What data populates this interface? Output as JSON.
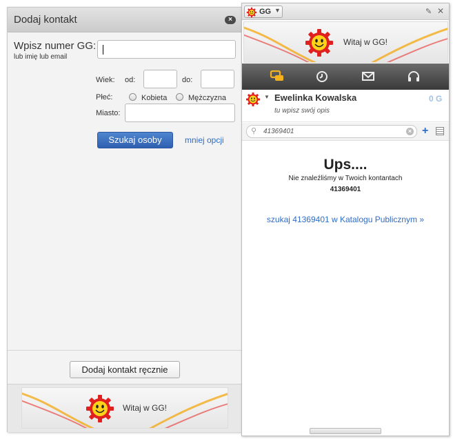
{
  "add_contact": {
    "title": "Dodaj kontakt",
    "gg_number_label": "Wpisz numer GG:",
    "gg_number_hint": "lub imię lub email",
    "gg_number_value": "",
    "age_label": "Wiek:",
    "from_label": "od:",
    "to_label": "do:",
    "gender_label": "Płeć:",
    "gender_female": "Kobieta",
    "gender_male": "Mężczyzna",
    "city_label": "Miasto:",
    "search_button": "Szukaj osoby",
    "less_options_link": "mniej opcji",
    "manual_add_button": "Dodaj kontakt ręcznie",
    "banner_text": "Witaj w GG!"
  },
  "main_window": {
    "menu_label": "GG",
    "banner_text": "Witaj w GG!",
    "toolbar": [
      "chat-icon",
      "clock-icon",
      "mail-icon",
      "headphones-icon"
    ],
    "profile": {
      "name": "Ewelinka Kowalska",
      "description": "tu wpisz swój opis",
      "gg_count": "0 G"
    },
    "search_value": "41369401",
    "result": {
      "title": "Ups....",
      "message": "Nie znaleźliśmy w Twoich kontantach",
      "number": "41369401",
      "catalog_link": "szukaj 41369401 w Katalogu Publicznym »"
    }
  },
  "colors": {
    "accent_blue": "#2f6cc5",
    "button_blue": "#3a6fc0",
    "toolbar_dark": "#4a4a4a",
    "active_icon": "#f3b21e"
  }
}
